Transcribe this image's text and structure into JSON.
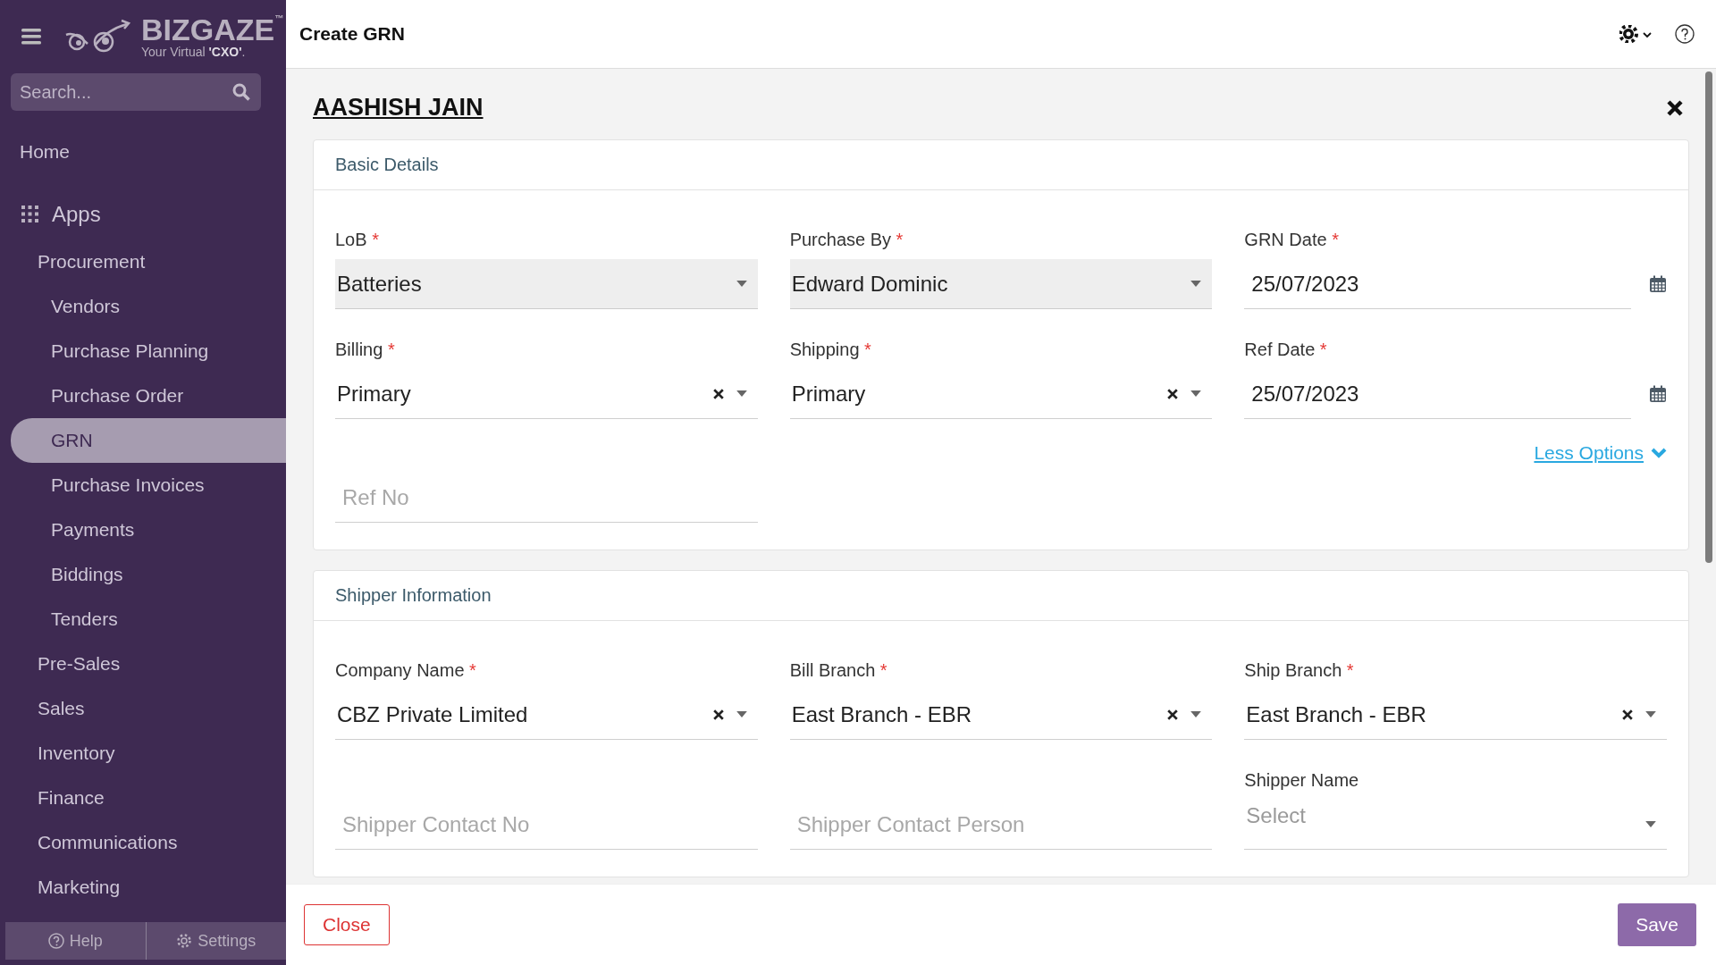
{
  "sidebar": {
    "logo": {
      "name": "BIZGAZE",
      "tm": "™",
      "tagline_prefix": "Your Virtual ",
      "tagline_bold": "'CXO'",
      "tagline_suffix": "."
    },
    "search": {
      "placeholder": "Search..."
    },
    "items": [
      {
        "label": "Home",
        "kind": "top",
        "selected": false
      },
      {
        "label": "Apps",
        "kind": "apps",
        "selected": false
      },
      {
        "label": "Procurement",
        "kind": "group",
        "selected": false
      },
      {
        "label": "Vendors",
        "kind": "sub",
        "selected": false
      },
      {
        "label": "Purchase Planning",
        "kind": "sub",
        "selected": false
      },
      {
        "label": "Purchase Order",
        "kind": "sub",
        "selected": false
      },
      {
        "label": "GRN",
        "kind": "sub",
        "selected": true
      },
      {
        "label": "Purchase Invoices",
        "kind": "sub",
        "selected": false
      },
      {
        "label": "Payments",
        "kind": "sub",
        "selected": false
      },
      {
        "label": "Biddings",
        "kind": "sub",
        "selected": false
      },
      {
        "label": "Tenders",
        "kind": "sub",
        "selected": false
      },
      {
        "label": "Pre-Sales",
        "kind": "group",
        "selected": false
      },
      {
        "label": "Sales",
        "kind": "group",
        "selected": false
      },
      {
        "label": "Inventory",
        "kind": "group",
        "selected": false
      },
      {
        "label": "Finance",
        "kind": "group",
        "selected": false
      },
      {
        "label": "Communications",
        "kind": "group",
        "selected": false
      },
      {
        "label": "Marketing",
        "kind": "group",
        "selected": false
      }
    ],
    "footer": [
      {
        "label": "Help",
        "kind": "help"
      },
      {
        "label": "Settings",
        "kind": "settings"
      }
    ]
  },
  "header": {
    "title": "Create GRN"
  },
  "form": {
    "party": "AASHISH JAIN",
    "sections": [
      {
        "title": "Basic Details",
        "fields": [
          {
            "kind": "select",
            "label": "LoB",
            "required_mark": "*",
            "value": "Batteries",
            "disabled": true,
            "clearable": false
          },
          {
            "kind": "select",
            "label": "Purchase By",
            "required_mark": "*",
            "value": "Edward Dominic",
            "disabled": true,
            "clearable": false
          },
          {
            "kind": "date",
            "label": "GRN Date",
            "required_mark": "*",
            "value": "25/07/2023",
            "disabled": false
          },
          {
            "kind": "select",
            "label": "Billing",
            "required_mark": "*",
            "value": "Primary",
            "disabled": false,
            "clearable": true
          },
          {
            "kind": "select",
            "label": "Shipping",
            "required_mark": "*",
            "value": "Primary",
            "disabled": false,
            "clearable": true
          },
          {
            "kind": "date",
            "label": "Ref Date",
            "required_mark": "*",
            "value": "25/07/2023",
            "disabled": false
          }
        ],
        "link": "Less Options",
        "extra_fields": [
          {
            "kind": "text",
            "placeholder": "Ref No",
            "disabled": false
          }
        ]
      },
      {
        "title": "Shipper Information",
        "fields": [
          {
            "kind": "select",
            "label": "Company Name",
            "required_mark": "*",
            "value": "CBZ Private Limited",
            "disabled": false,
            "clearable": true
          },
          {
            "kind": "select",
            "label": "Bill Branch",
            "required_mark": "*",
            "value": "East Branch - EBR",
            "disabled": false,
            "clearable": true
          },
          {
            "kind": "select",
            "label": "Ship Branch",
            "required_mark": "*",
            "value": "East Branch - EBR",
            "disabled": false,
            "clearable": true
          },
          {
            "kind": "text",
            "placeholder": "Shipper Contact No",
            "disabled": false
          },
          {
            "kind": "text",
            "placeholder": "Shipper Contact Person",
            "disabled": false
          },
          {
            "kind": "select",
            "label": "Shipper Name",
            "placeholder": "Select",
            "disabled": false,
            "clearable": false
          }
        ]
      }
    ]
  },
  "footer": {
    "close": "Close",
    "save": "Save"
  }
}
